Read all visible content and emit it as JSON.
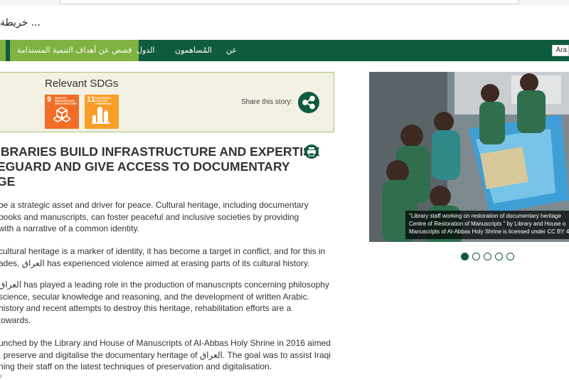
{
  "header": {
    "brand": "خريطة ..."
  },
  "nav": {
    "items": [
      {
        "label": "قصص عن أهداف التنمية المستدامة"
      },
      {
        "label": "الدول"
      },
      {
        "label": "المُساهمون"
      },
      {
        "label": "عن"
      }
    ],
    "lang": "Ara"
  },
  "sdg": {
    "title": "Relevant SDGs",
    "tiles": [
      {
        "num": "9",
        "text": "INDUSTRY, INNOVATION AND INFRASTRUCTURE",
        "color": "#f36d25"
      },
      {
        "num": "11",
        "text": "SUSTAINABLE CITIES AND COMMUNITIES",
        "color": "#f99d26"
      }
    ],
    "share_label": "Share this story:"
  },
  "article": {
    "title_lines": [
      "IBRARIES BUILD INFRASTRUCTURE AND EXPERTISE",
      "EGUARD AND GIVE ACCESS TO DOCUMENTARY",
      "GE"
    ],
    "paragraphs": [
      [
        "be a strategic asset and driver for peace. Cultural heritage, including documentary",
        "books and manuscripts, can foster peaceful and inclusive societies by providing",
        "with a narrative of a common identity."
      ],
      [
        "cultural heritage is a marker of identity, it has become a target in conflict, and for this in",
        "ades, العراق has experienced violence aimed at erasing parts of its cultural history."
      ],
      [
        "العراق has played a leading role in the production of manuscripts concerning philosophy",
        "science, secular knowledge and reasoning, and the development of written Arabic.",
        "history and recent attempts to destroy this heritage, rehabilitation efforts are a",
        "towards."
      ],
      [
        "unched by the Library and House of Manuscripts of Al-Abbas Holy Shrine in 2016 aimed",
        ", preserve and digitalise the documentary heritage of العراق. The goal was to assist Iraqi",
        "ning their staff on the latest techniques of preservation and digitalisation."
      ]
    ],
    "bottom_tag": "p"
  },
  "photo": {
    "caption_lines": [
      "\"Library staff working on restoration of documentary heritage",
      "Centre of Restoration of Manuscripts \" by Library and House o",
      "Manuscripts of Al-Abbas Holy Shrine is licensed under CC BY 4"
    ],
    "slides": 5,
    "active_slide": 1
  },
  "colors": {
    "nav_green": "#0f5b3e",
    "accent_green": "#7fb241"
  }
}
